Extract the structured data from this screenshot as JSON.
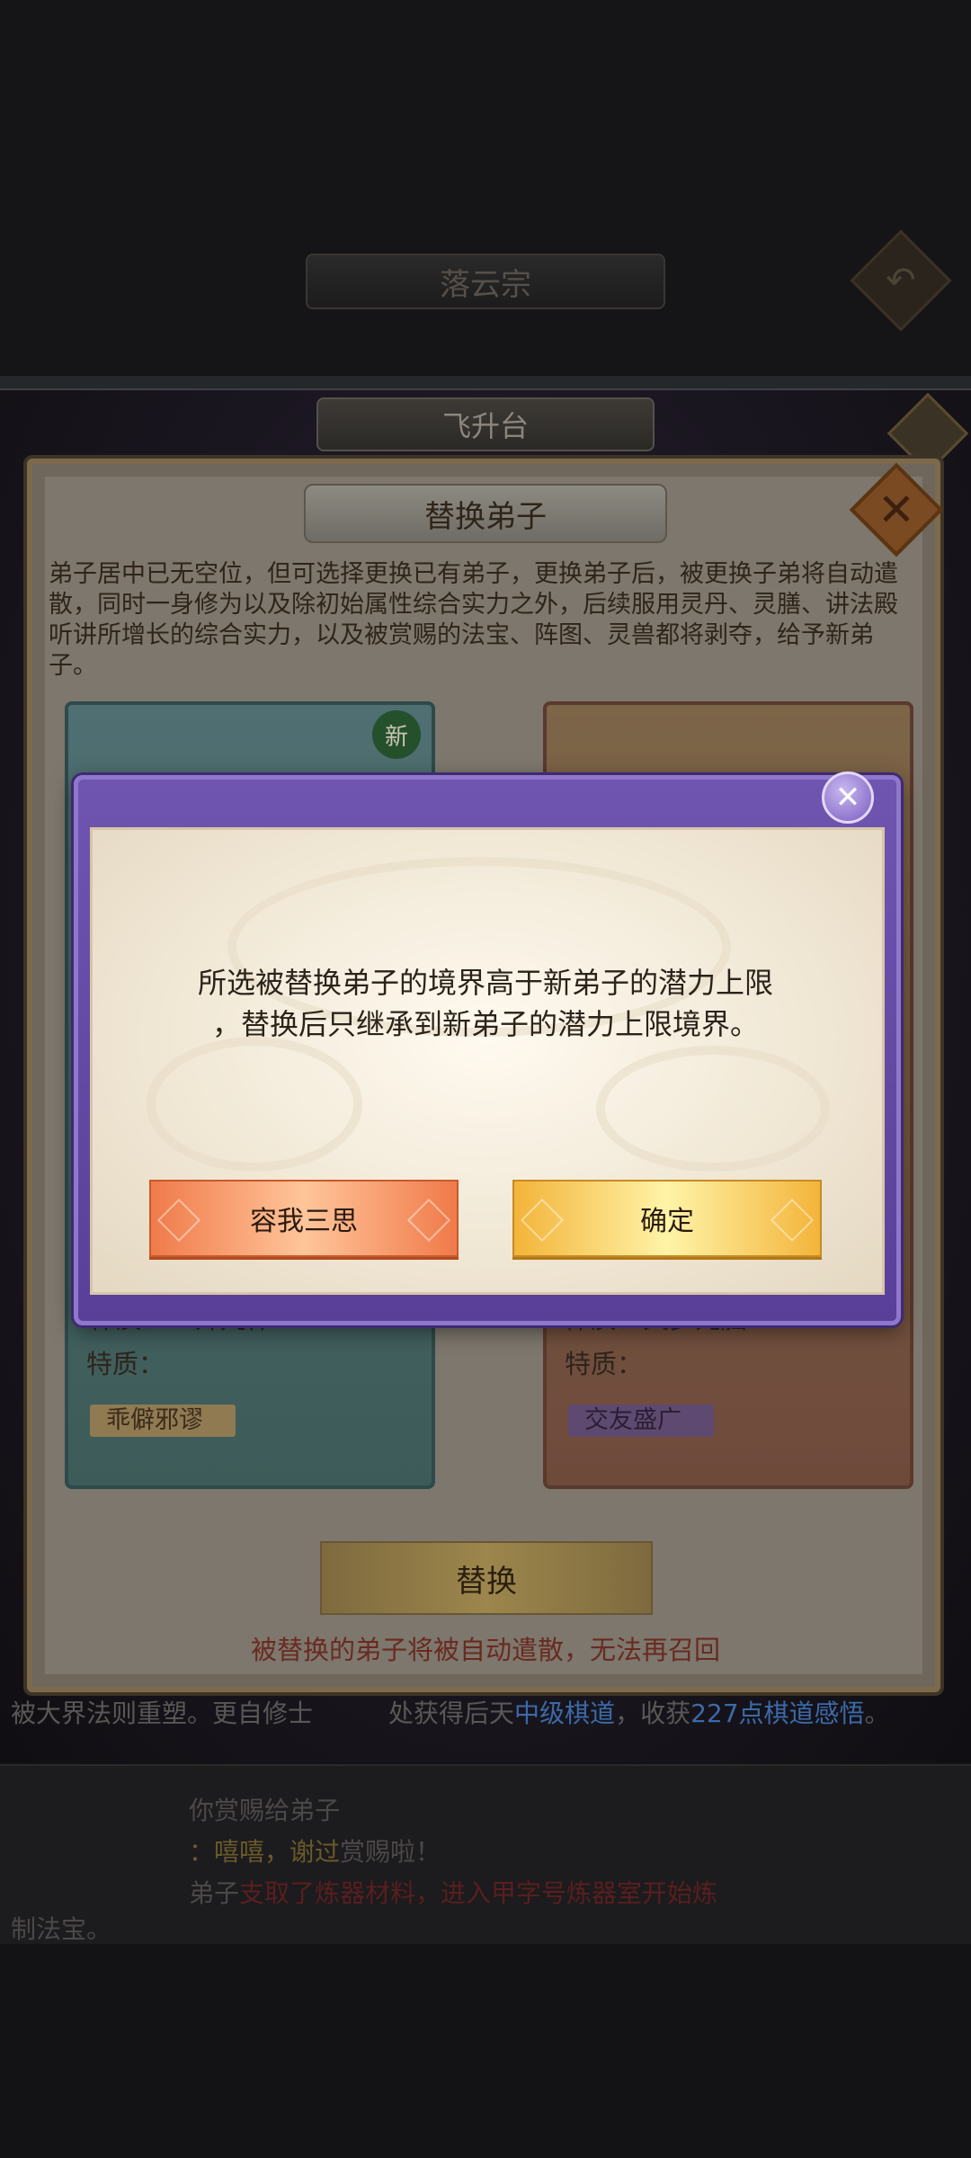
{
  "scene": {
    "sect_title": "落云宗",
    "feisheng_title": "飞升台",
    "log_line": {
      "part1": "被大界法则重塑。更自修士",
      "part2": "处获得后天",
      "link": "中级棋道",
      "part3": "，收获",
      "link2": "227点棋道感悟",
      "part4": "。"
    },
    "bottom_log": [
      "你赏赐给弟子",
      "：嘻嘻，谢过",
      "赏赐啦！",
      "弟子",
      "支取了炼器材料，进入甲字号炼器室开始炼",
      "制法宝。"
    ]
  },
  "panel": {
    "title": "替换弟子",
    "description": "弟子居中已无空位，但可选择更换已有弟子，更换弟子后，被更换子弟将自动遣散，同时一身修为以及除初始属性综合实力之外，后续服用灵丹、灵膳、讲法殿听讲所增长的综合实力，以及被赏赐的法宝、阵图、灵兽都将剥夺，给予新弟子。",
    "new_badge": "新",
    "left_card": {
      "physique": "体质：一介凡体",
      "trait_label": "特质：",
      "trait": "乖僻邪谬"
    },
    "right_card": {
      "physique": "体质：天罗元脑",
      "trait_label": "特质：",
      "trait": "交友盛广"
    },
    "replace_button": "替换",
    "warning": "被替换的弟子将被自动遣散，无法再召回"
  },
  "dialog": {
    "message_line1": "所选被替换弟子的境界高于新弟子的潜力上限",
    "message_line2": "，替换后只继承到新弟子的潜力上限境界。",
    "cancel_label": "容我三思",
    "confirm_label": "确定",
    "close_icon": "close-icon"
  },
  "colors": {
    "dialog_frame": "#6f55b0",
    "cancel_button": "#f07a4a",
    "confirm_button": "#f3b43a",
    "warning_text": "#6a2a20"
  }
}
